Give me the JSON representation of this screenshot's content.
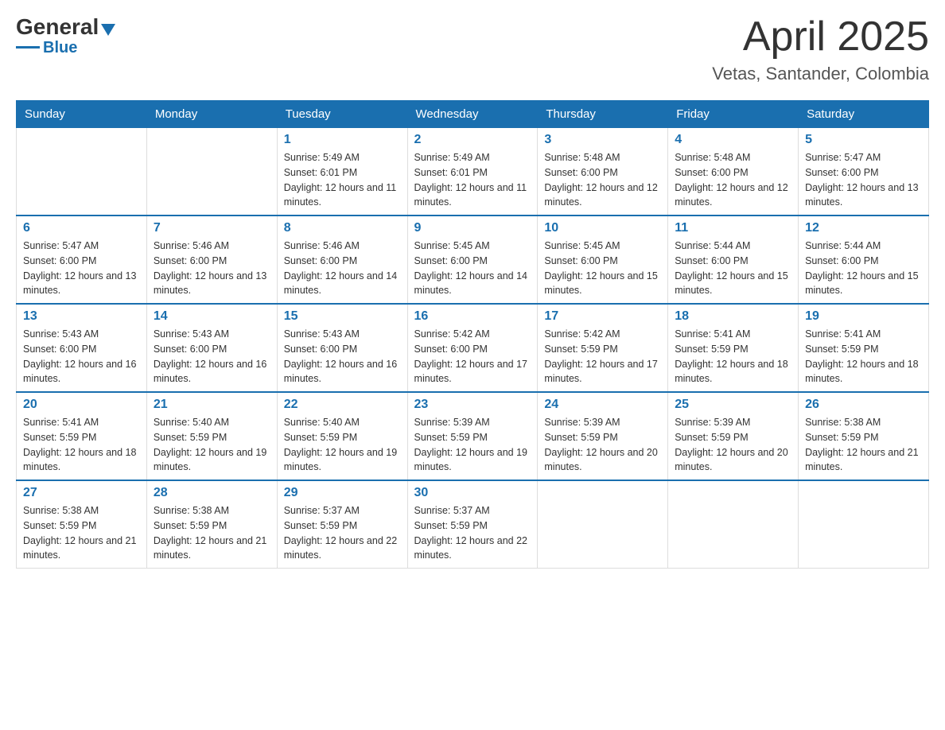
{
  "header": {
    "logo": {
      "general": "General",
      "blue": "Blue",
      "triangle": true
    },
    "title": "April 2025",
    "location": "Vetas, Santander, Colombia"
  },
  "weekdays": [
    "Sunday",
    "Monday",
    "Tuesday",
    "Wednesday",
    "Thursday",
    "Friday",
    "Saturday"
  ],
  "weeks": [
    [
      {
        "day": "",
        "sunrise": "",
        "sunset": "",
        "daylight": ""
      },
      {
        "day": "",
        "sunrise": "",
        "sunset": "",
        "daylight": ""
      },
      {
        "day": "1",
        "sunrise": "Sunrise: 5:49 AM",
        "sunset": "Sunset: 6:01 PM",
        "daylight": "Daylight: 12 hours and 11 minutes."
      },
      {
        "day": "2",
        "sunrise": "Sunrise: 5:49 AM",
        "sunset": "Sunset: 6:01 PM",
        "daylight": "Daylight: 12 hours and 11 minutes."
      },
      {
        "day": "3",
        "sunrise": "Sunrise: 5:48 AM",
        "sunset": "Sunset: 6:00 PM",
        "daylight": "Daylight: 12 hours and 12 minutes."
      },
      {
        "day": "4",
        "sunrise": "Sunrise: 5:48 AM",
        "sunset": "Sunset: 6:00 PM",
        "daylight": "Daylight: 12 hours and 12 minutes."
      },
      {
        "day": "5",
        "sunrise": "Sunrise: 5:47 AM",
        "sunset": "Sunset: 6:00 PM",
        "daylight": "Daylight: 12 hours and 13 minutes."
      }
    ],
    [
      {
        "day": "6",
        "sunrise": "Sunrise: 5:47 AM",
        "sunset": "Sunset: 6:00 PM",
        "daylight": "Daylight: 12 hours and 13 minutes."
      },
      {
        "day": "7",
        "sunrise": "Sunrise: 5:46 AM",
        "sunset": "Sunset: 6:00 PM",
        "daylight": "Daylight: 12 hours and 13 minutes."
      },
      {
        "day": "8",
        "sunrise": "Sunrise: 5:46 AM",
        "sunset": "Sunset: 6:00 PM",
        "daylight": "Daylight: 12 hours and 14 minutes."
      },
      {
        "day": "9",
        "sunrise": "Sunrise: 5:45 AM",
        "sunset": "Sunset: 6:00 PM",
        "daylight": "Daylight: 12 hours and 14 minutes."
      },
      {
        "day": "10",
        "sunrise": "Sunrise: 5:45 AM",
        "sunset": "Sunset: 6:00 PM",
        "daylight": "Daylight: 12 hours and 15 minutes."
      },
      {
        "day": "11",
        "sunrise": "Sunrise: 5:44 AM",
        "sunset": "Sunset: 6:00 PM",
        "daylight": "Daylight: 12 hours and 15 minutes."
      },
      {
        "day": "12",
        "sunrise": "Sunrise: 5:44 AM",
        "sunset": "Sunset: 6:00 PM",
        "daylight": "Daylight: 12 hours and 15 minutes."
      }
    ],
    [
      {
        "day": "13",
        "sunrise": "Sunrise: 5:43 AM",
        "sunset": "Sunset: 6:00 PM",
        "daylight": "Daylight: 12 hours and 16 minutes."
      },
      {
        "day": "14",
        "sunrise": "Sunrise: 5:43 AM",
        "sunset": "Sunset: 6:00 PM",
        "daylight": "Daylight: 12 hours and 16 minutes."
      },
      {
        "day": "15",
        "sunrise": "Sunrise: 5:43 AM",
        "sunset": "Sunset: 6:00 PM",
        "daylight": "Daylight: 12 hours and 16 minutes."
      },
      {
        "day": "16",
        "sunrise": "Sunrise: 5:42 AM",
        "sunset": "Sunset: 6:00 PM",
        "daylight": "Daylight: 12 hours and 17 minutes."
      },
      {
        "day": "17",
        "sunrise": "Sunrise: 5:42 AM",
        "sunset": "Sunset: 5:59 PM",
        "daylight": "Daylight: 12 hours and 17 minutes."
      },
      {
        "day": "18",
        "sunrise": "Sunrise: 5:41 AM",
        "sunset": "Sunset: 5:59 PM",
        "daylight": "Daylight: 12 hours and 18 minutes."
      },
      {
        "day": "19",
        "sunrise": "Sunrise: 5:41 AM",
        "sunset": "Sunset: 5:59 PM",
        "daylight": "Daylight: 12 hours and 18 minutes."
      }
    ],
    [
      {
        "day": "20",
        "sunrise": "Sunrise: 5:41 AM",
        "sunset": "Sunset: 5:59 PM",
        "daylight": "Daylight: 12 hours and 18 minutes."
      },
      {
        "day": "21",
        "sunrise": "Sunrise: 5:40 AM",
        "sunset": "Sunset: 5:59 PM",
        "daylight": "Daylight: 12 hours and 19 minutes."
      },
      {
        "day": "22",
        "sunrise": "Sunrise: 5:40 AM",
        "sunset": "Sunset: 5:59 PM",
        "daylight": "Daylight: 12 hours and 19 minutes."
      },
      {
        "day": "23",
        "sunrise": "Sunrise: 5:39 AM",
        "sunset": "Sunset: 5:59 PM",
        "daylight": "Daylight: 12 hours and 19 minutes."
      },
      {
        "day": "24",
        "sunrise": "Sunrise: 5:39 AM",
        "sunset": "Sunset: 5:59 PM",
        "daylight": "Daylight: 12 hours and 20 minutes."
      },
      {
        "day": "25",
        "sunrise": "Sunrise: 5:39 AM",
        "sunset": "Sunset: 5:59 PM",
        "daylight": "Daylight: 12 hours and 20 minutes."
      },
      {
        "day": "26",
        "sunrise": "Sunrise: 5:38 AM",
        "sunset": "Sunset: 5:59 PM",
        "daylight": "Daylight: 12 hours and 21 minutes."
      }
    ],
    [
      {
        "day": "27",
        "sunrise": "Sunrise: 5:38 AM",
        "sunset": "Sunset: 5:59 PM",
        "daylight": "Daylight: 12 hours and 21 minutes."
      },
      {
        "day": "28",
        "sunrise": "Sunrise: 5:38 AM",
        "sunset": "Sunset: 5:59 PM",
        "daylight": "Daylight: 12 hours and 21 minutes."
      },
      {
        "day": "29",
        "sunrise": "Sunrise: 5:37 AM",
        "sunset": "Sunset: 5:59 PM",
        "daylight": "Daylight: 12 hours and 22 minutes."
      },
      {
        "day": "30",
        "sunrise": "Sunrise: 5:37 AM",
        "sunset": "Sunset: 5:59 PM",
        "daylight": "Daylight: 12 hours and 22 minutes."
      },
      {
        "day": "",
        "sunrise": "",
        "sunset": "",
        "daylight": ""
      },
      {
        "day": "",
        "sunrise": "",
        "sunset": "",
        "daylight": ""
      },
      {
        "day": "",
        "sunrise": "",
        "sunset": "",
        "daylight": ""
      }
    ]
  ]
}
